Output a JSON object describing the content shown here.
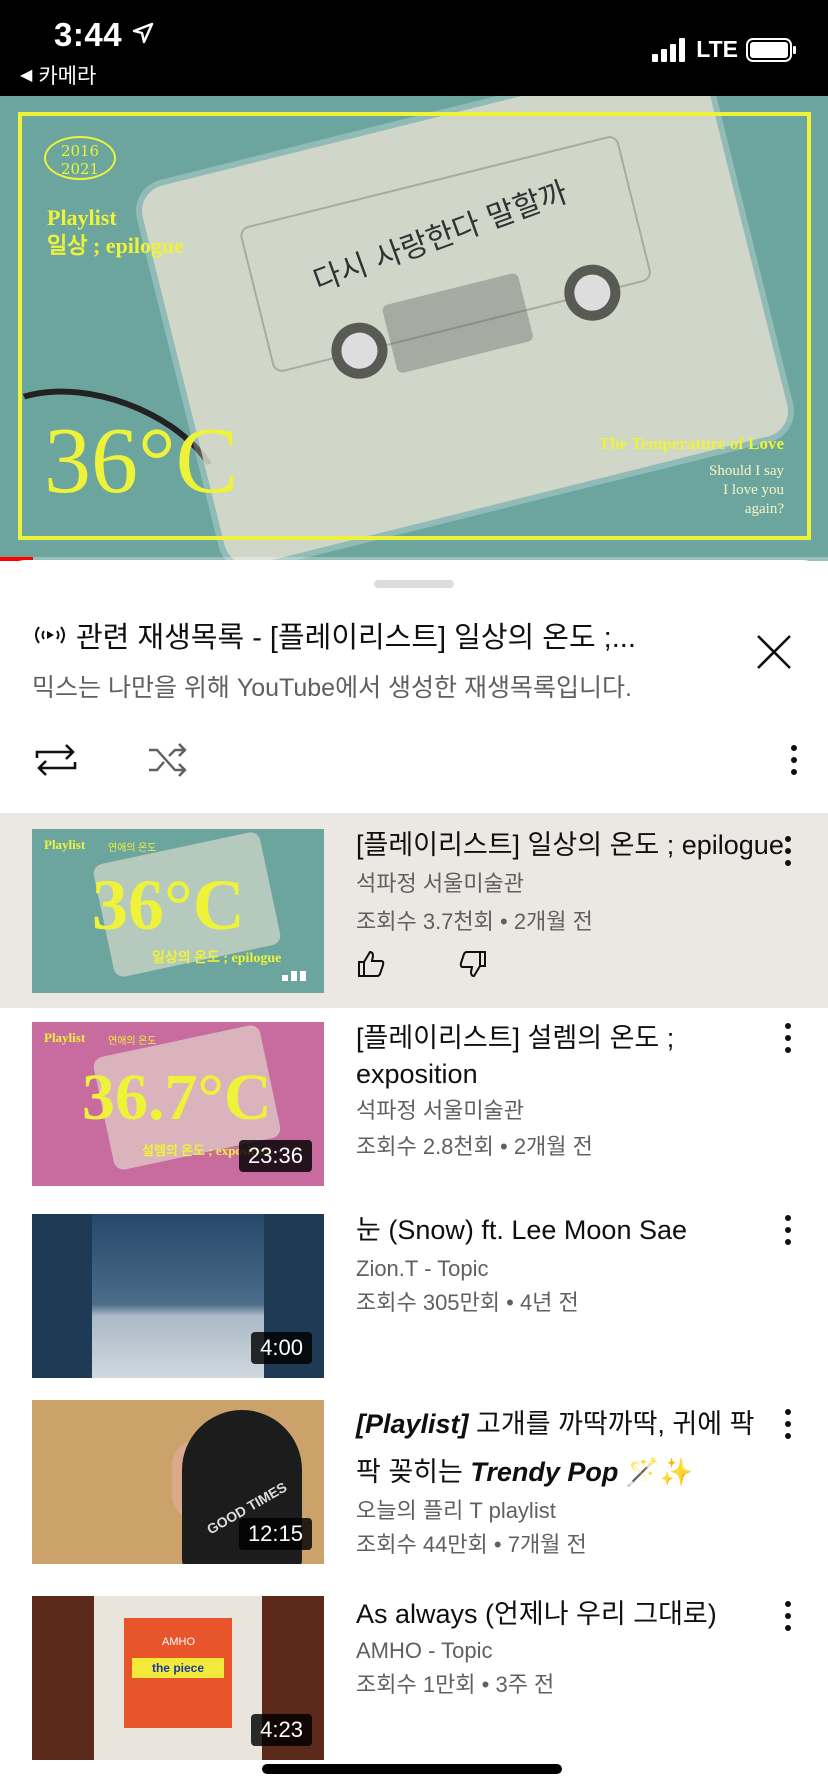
{
  "status_bar": {
    "time": "3:44",
    "back_app": "카메라",
    "network": "LTE",
    "battery_icon": "battery-icon",
    "signal_icon": "signal-bars-icon",
    "location_icon": "location-arrow-icon"
  },
  "player": {
    "overlay_years": "2016\n2021",
    "overlay_title_1": "Playlist",
    "overlay_title_2": "일상 ; epilogue",
    "overlay_temp": "36°C",
    "overlay_handwriting": "다시 사랑한다 말할까",
    "overlay_love": "The Temperature of Love",
    "overlay_again": "Should I say\nI love you\nagain?",
    "progress": 0.04,
    "accent_color": "#ff0000",
    "frame_color": "#eef33a"
  },
  "sheet": {
    "title": "관련 재생목록 - [플레이리스트] 일상의 온도 ;...",
    "subtitle": "믹스는 나만을 위해 YouTube에서 생성한 재생목록입니다.",
    "icons": {
      "mix": "radio-mix-icon",
      "close": "close-icon",
      "repeat": "repeat-icon",
      "shuffle": "shuffle-icon",
      "more": "more-vertical-icon"
    }
  },
  "videos": [
    {
      "title": "[플레이리스트] 일상의 온도 ; epilogue",
      "channel": "석파정 서울미술관",
      "stats": "조회수 3.7천회 • 2개월 전",
      "duration": "",
      "thumb_title": "Playlist",
      "thumb_sub": "연애의 온도",
      "thumb_text": "36°C",
      "thumb_caption": "일상의 온도 ; epilogue",
      "now_playing": true
    },
    {
      "title": "[플레이리스트] 설렘의 온도 ; exposition",
      "channel": "석파정 서울미술관",
      "stats": "조회수 2.8천회 • 2개월 전",
      "duration": "23:36",
      "thumb_title": "Playlist",
      "thumb_sub": "연애의 온도",
      "thumb_text": "36.7°C",
      "thumb_caption": "설렘의 온도 ; exposition"
    },
    {
      "title": "눈 (Snow) ft. Lee Moon Sae",
      "channel": "Zion.T - Topic",
      "stats": "조회수 305만회 • 4년 전",
      "duration": "4:00"
    },
    {
      "title_prefix": "[Playlist]",
      "title_mid": " 고개를 까딱까딱, 귀에 팍팍 꽂히는 ",
      "title_em": "Trendy Pop",
      "title_emoji": " 🪄✨",
      "channel": "오늘의 플리 T playlist",
      "stats": "조회수 44만회 • 7개월 전",
      "duration": "12:15",
      "thumb_text": "GOOD TIMES"
    },
    {
      "title": "As always (언제나 우리 그대로)",
      "channel": "AMHO - Topic",
      "stats": "조회수 1만회 • 3주 전",
      "duration": "4:23",
      "thumb_label": "the piece",
      "thumb_brand": "AMHO"
    }
  ]
}
